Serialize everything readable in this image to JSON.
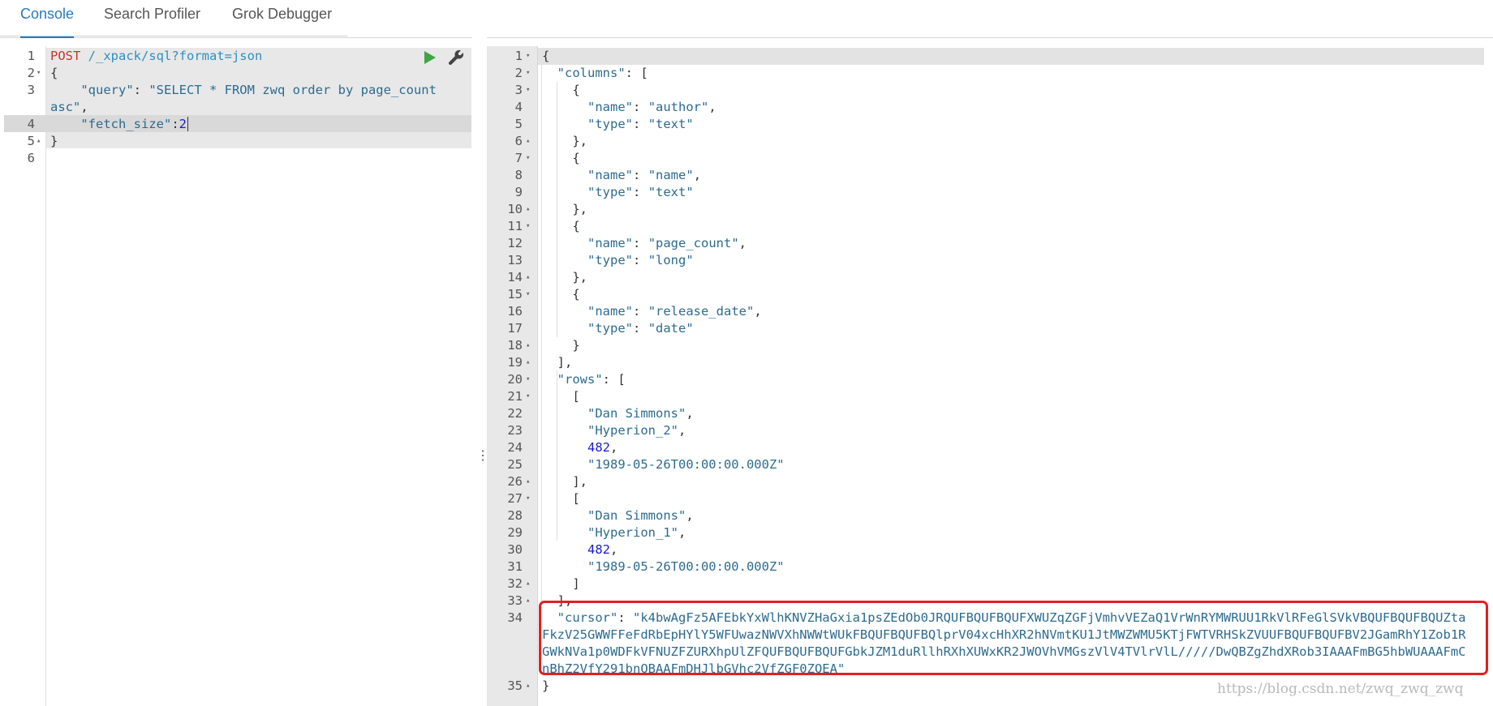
{
  "tabs": [
    {
      "label": "Console",
      "active": true
    },
    {
      "label": "Search Profiler",
      "active": false
    },
    {
      "label": "Grok Debugger",
      "active": false
    }
  ],
  "request": {
    "method": "POST",
    "url": "/_xpack/sql?format=json",
    "lines": [
      {
        "n": "1",
        "fold": ""
      },
      {
        "n": "2",
        "fold": "▾"
      },
      {
        "n": "3",
        "fold": ""
      },
      {
        "n": "4",
        "fold": ""
      },
      {
        "n": "5",
        "fold": "▴"
      },
      {
        "n": "6",
        "fold": ""
      }
    ],
    "open_brace": "{",
    "close_brace": "}",
    "query_key": "\"query\"",
    "query_value_part1": "\"SELECT * FROM zwq order by page_count",
    "query_value_part2": "asc\"",
    "fetch_key": "\"fetch_size\"",
    "fetch_value": "2"
  },
  "response_lines": [
    {
      "n": "1",
      "fold": "▾",
      "text": "{"
    },
    {
      "n": "2",
      "fold": "▾",
      "text": "  \"columns\": ["
    },
    {
      "n": "3",
      "fold": "▾",
      "text": "    {"
    },
    {
      "n": "4",
      "fold": "",
      "text": "      \"name\": \"author\","
    },
    {
      "n": "5",
      "fold": "",
      "text": "      \"type\": \"text\""
    },
    {
      "n": "6",
      "fold": "▴",
      "text": "    },"
    },
    {
      "n": "7",
      "fold": "▾",
      "text": "    {"
    },
    {
      "n": "8",
      "fold": "",
      "text": "      \"name\": \"name\","
    },
    {
      "n": "9",
      "fold": "",
      "text": "      \"type\": \"text\""
    },
    {
      "n": "10",
      "fold": "▴",
      "text": "    },"
    },
    {
      "n": "11",
      "fold": "▾",
      "text": "    {"
    },
    {
      "n": "12",
      "fold": "",
      "text": "      \"name\": \"page_count\","
    },
    {
      "n": "13",
      "fold": "",
      "text": "      \"type\": \"long\""
    },
    {
      "n": "14",
      "fold": "▴",
      "text": "    },"
    },
    {
      "n": "15",
      "fold": "▾",
      "text": "    {"
    },
    {
      "n": "16",
      "fold": "",
      "text": "      \"name\": \"release_date\","
    },
    {
      "n": "17",
      "fold": "",
      "text": "      \"type\": \"date\""
    },
    {
      "n": "18",
      "fold": "▴",
      "text": "    }"
    },
    {
      "n": "19",
      "fold": "▴",
      "text": "  ],"
    },
    {
      "n": "20",
      "fold": "▾",
      "text": "  \"rows\": ["
    },
    {
      "n": "21",
      "fold": "▾",
      "text": "    ["
    },
    {
      "n": "22",
      "fold": "",
      "text": "      \"Dan Simmons\","
    },
    {
      "n": "23",
      "fold": "",
      "text": "      \"Hyperion_2\","
    },
    {
      "n": "24",
      "fold": "",
      "text": "      482,"
    },
    {
      "n": "25",
      "fold": "",
      "text": "      \"1989-05-26T00:00:00.000Z\""
    },
    {
      "n": "26",
      "fold": "▴",
      "text": "    ],"
    },
    {
      "n": "27",
      "fold": "▾",
      "text": "    ["
    },
    {
      "n": "28",
      "fold": "",
      "text": "      \"Dan Simmons\","
    },
    {
      "n": "29",
      "fold": "",
      "text": "      \"Hyperion_1\","
    },
    {
      "n": "30",
      "fold": "",
      "text": "      482,"
    },
    {
      "n": "31",
      "fold": "",
      "text": "      \"1989-05-26T00:00:00.000Z\""
    },
    {
      "n": "32",
      "fold": "▴",
      "text": "    ]"
    },
    {
      "n": "33",
      "fold": "▴",
      "text": "  ],"
    }
  ],
  "cursor_line": {
    "n": "34",
    "key": "\"cursor\"",
    "value_lines": [
      "\"k4bwAgFz5AFEbkYxWlhKNVZHaGxia1psZEdOb0JRQUFBQUFBQUFXWUZqZGFjVmhvVEZaQ1VrWnRYMWRUU1RkVlRFeGlSVkVBQUFBQUFBQUZta",
      "FkzV25GWWFFeFdRbEpHYlY5WFUwazNWVXhNWWtWUkFBQUFBQUFBQlprV04xcHhXR2hNVmtKU1JtMWZWMU5KTjFWTVRHSkZVUUFBQUFBQUFBV2JGamRhY1Zob1R",
      "GWkNVa1p0WDFkVFNUZFZURXhpUlZFQUFBQUFBQUFGbkJZM1duRllhRXhXUWxKR2JWOVhVMGszVlV4TVlrVlL/////DwQBZgZhdXRob3IAAAFmBG5hbWUAAAFmC",
      "nBhZ2VfY291bnQBAAFmDHJlbGVhc2VfZGF0ZQEA\""
    ]
  },
  "last_line": {
    "n": "35",
    "fold": "▴",
    "text": "}"
  },
  "watermark": "https://blog.csdn.net/zwq_zwq_zwq"
}
